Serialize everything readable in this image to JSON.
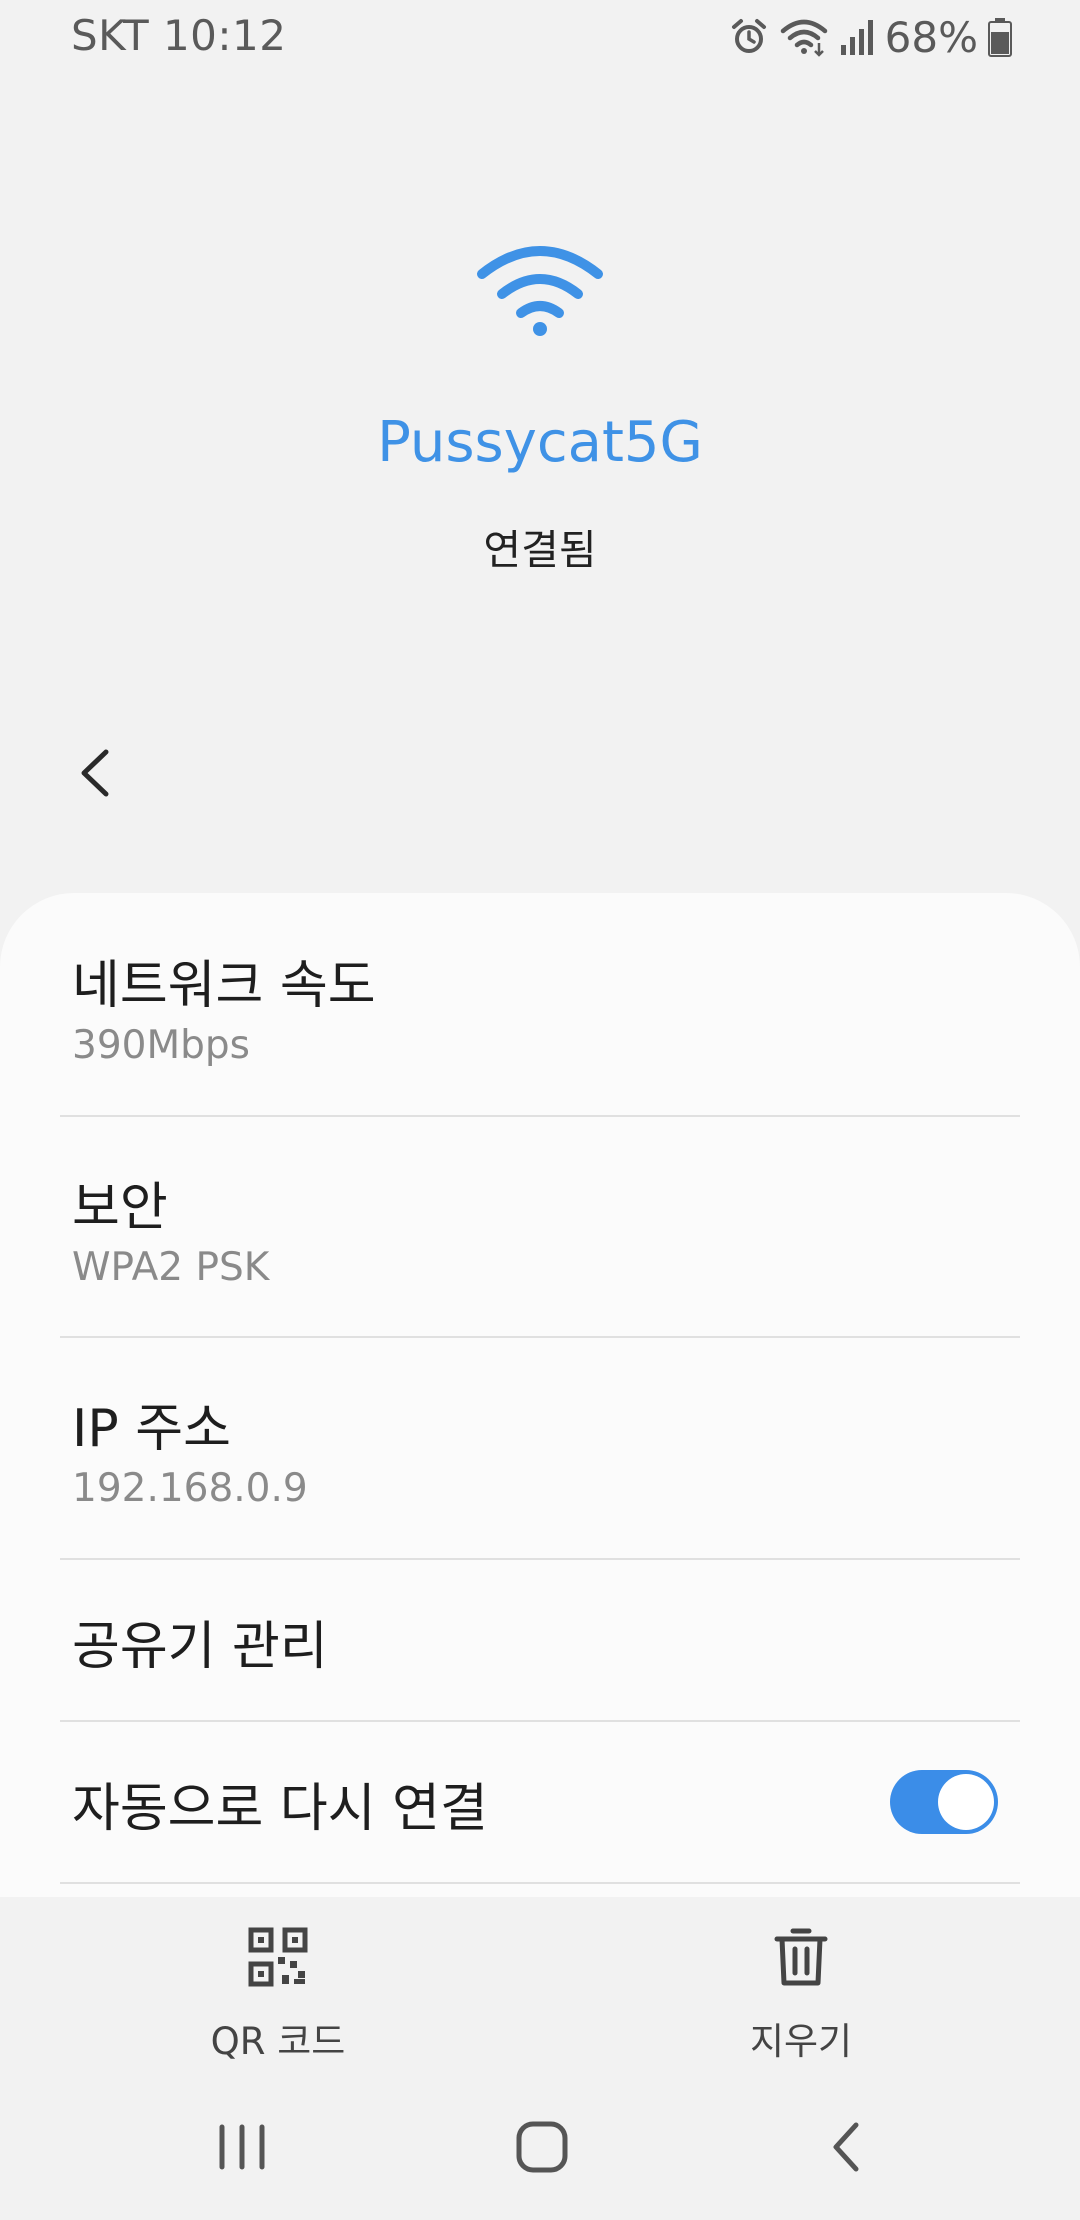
{
  "status_bar": {
    "carrier_time": "SKT 10:12",
    "battery": "68%",
    "icons": [
      "alarm-icon",
      "wifi-icon",
      "signal-icon",
      "battery-icon"
    ]
  },
  "header": {
    "icon": "wifi-icon",
    "network_name": "Pussycat5G",
    "status": "연결됨"
  },
  "nav": {
    "back_icon": "chevron-left-icon"
  },
  "details": {
    "speed": {
      "label": "네트워크 속도",
      "value": "390Mbps"
    },
    "security": {
      "label": "보안",
      "value": "WPA2 PSK"
    },
    "ip": {
      "label": "IP 주소",
      "value": "192.168.0.9"
    },
    "router": {
      "label": "공유기 관리"
    },
    "auto_reconnect": {
      "label": "자동으로 다시 연결",
      "enabled": true
    }
  },
  "actions": {
    "qr": {
      "label": "QR 코드",
      "icon": "qr-code-icon"
    },
    "delete": {
      "label": "지우기",
      "icon": "trash-icon"
    }
  },
  "system_nav": [
    "recent-apps-icon",
    "home-icon",
    "back-icon"
  ],
  "colors": {
    "accent": "#3f92e6",
    "toggle": "#3b8de8",
    "background": "#f2f2f2",
    "card": "#fbfbfb"
  }
}
